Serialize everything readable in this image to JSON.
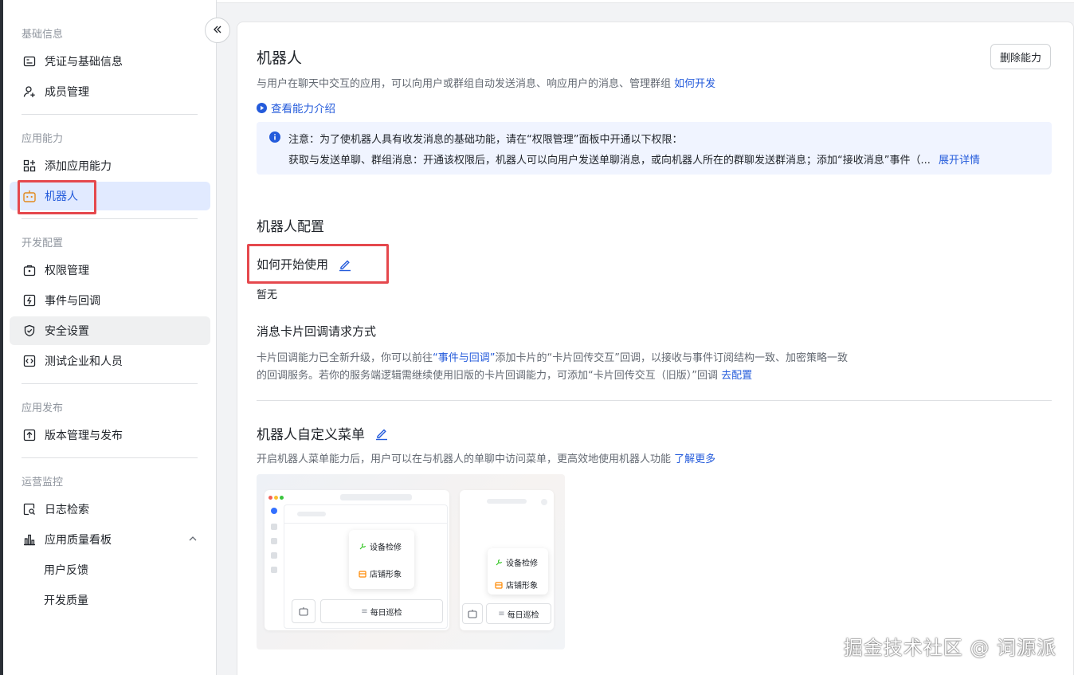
{
  "sidebar": {
    "groups": {
      "basic": "基础信息",
      "capability": "应用能力",
      "dev": "开发配置",
      "release": "应用发布",
      "ops": "运营监控"
    },
    "items": {
      "credentials": "凭证与基础信息",
      "members": "成员管理",
      "add_capability": "添加应用能力",
      "bot": "机器人",
      "permissions": "权限管理",
      "events": "事件与回调",
      "security": "安全设置",
      "test_org": "测试企业和人员",
      "version": "版本管理与发布",
      "logs": "日志检索",
      "quality_board": "应用质量看板",
      "feedback": "用户反馈",
      "dev_quality": "开发质量"
    }
  },
  "main": {
    "title": "机器人",
    "desc": "与用户在聊天中交互的应用，可以向用户或群组自动发送消息、响应用户的消息、管理群组",
    "desc_link": "如何开发",
    "intro_link": "查看能力介绍",
    "delete_button": "删除能力",
    "notice": {
      "line1": "注意：为了使机器人具有收发消息的基础功能，请在“权限管理”面板中开通以下权限：",
      "line2": "获取与发送单聊、群组消息：开通该权限后，机器人可以向用户发送单聊消息，或向机器人所在的群聊发送群消息；添加“接收消息”事件（...",
      "expand": "展开详情"
    },
    "config_title": "机器人配置",
    "how_to_start": "如何开始使用",
    "none_text": "暂无",
    "card_callback": {
      "title": "消息卡片回调请求方式",
      "line1_a": "卡片回调能力已全新升级，你可以前往",
      "line1_link": "“事件与回调”",
      "line1_b": "添加卡片的“卡片回传交互”回调，以接收与事件订阅结构一致、加密策略一致",
      "line2": "的回调服务。若你的服务端逻辑需继续使用旧版的卡片回调能力，可添加“卡片回传交互（旧版）”回调",
      "line2_link": "去配置"
    },
    "menu": {
      "title": "机器人自定义菜单",
      "desc": "开启机器人菜单能力后，用户可以在与机器人的单聊中访问菜单，更高效地使用机器人功能",
      "desc_link": "了解更多",
      "preview": {
        "item1": "设备检修",
        "item2": "店铺形象",
        "input": "每日巡检"
      }
    }
  },
  "watermark": "掘金技术社区 @ 词源派",
  "colors": {
    "accent": "#245bdb",
    "highlight": "#e5484d",
    "active_bg": "#e1eaff"
  }
}
